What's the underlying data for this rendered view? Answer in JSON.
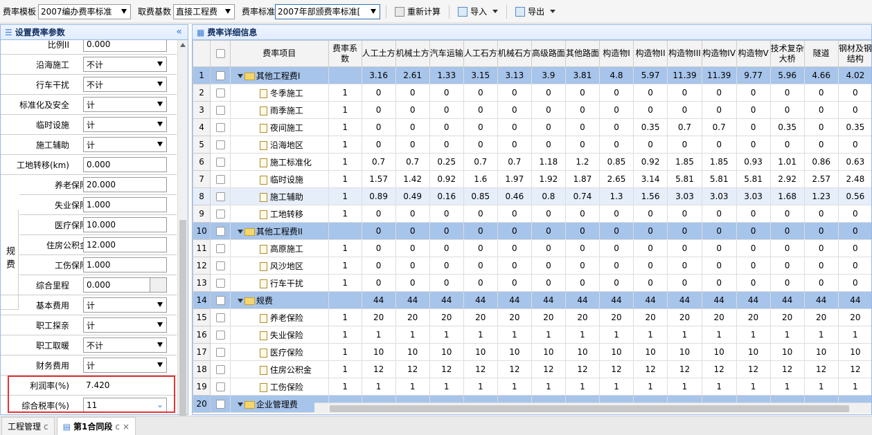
{
  "toolbar": {
    "template_label": "费率模板",
    "template_value": "2007编办费率标准",
    "base_label": "取费基数",
    "base_value": "直接工程费",
    "standard_label": "费率标准",
    "standard_value": "2007年部颁费率标准[",
    "recalc_label": "重新计算",
    "import_label": "导入",
    "export_label": "导出"
  },
  "left_panel": {
    "title": "设置费率参数",
    "collapse_icon": "double-chevron-left",
    "group_label": "规费",
    "rows": [
      {
        "label": "比例II",
        "value": "0.000",
        "type": "text"
      },
      {
        "label": "沿海施工",
        "value": "不计",
        "type": "select"
      },
      {
        "label": "行车干扰",
        "value": "不计",
        "type": "select"
      },
      {
        "label": "标准化及安全",
        "value": "计",
        "type": "select"
      },
      {
        "label": "临时设施",
        "value": "计",
        "type": "select"
      },
      {
        "label": "施工辅助",
        "value": "计",
        "type": "select"
      },
      {
        "label": "工地转移(km)",
        "value": "0.000",
        "type": "text"
      },
      {
        "label": "养老保险",
        "value": "20.000",
        "type": "text"
      },
      {
        "label": "失业保险",
        "value": "1.000",
        "type": "text"
      },
      {
        "label": "医疗保险",
        "value": "10.000",
        "type": "text"
      },
      {
        "label": "住房公积金",
        "value": "12.000",
        "type": "text"
      },
      {
        "label": "工伤保险",
        "value": "1.000",
        "type": "text"
      },
      {
        "label": "综合里程",
        "value": "0.000",
        "type": "date"
      },
      {
        "label": "基本费用",
        "value": "计",
        "type": "select"
      },
      {
        "label": "职工探亲",
        "value": "计",
        "type": "select"
      },
      {
        "label": "职工取暖",
        "value": "不计",
        "type": "select"
      },
      {
        "label": "财务费用",
        "value": "计",
        "type": "select"
      },
      {
        "label": "利润率(%)",
        "value": "7.420",
        "type": "plain"
      },
      {
        "label": "综合税率(%)",
        "value": "11",
        "type": "combo"
      }
    ]
  },
  "right_panel": {
    "title": "费率详细信息",
    "columns": [
      "费率项目",
      "费率系数",
      "人工土方",
      "机械土方",
      "汽车运输",
      "人工石方",
      "机械石方",
      "高级路面",
      "其他路面",
      "构造物I",
      "构造物II",
      "构造物III",
      "构造物IV",
      "构造物V",
      "技术复杂大桥",
      "隧道",
      "钢材及钢结构"
    ],
    "rows": [
      {
        "n": "1",
        "name": "其他工程费I",
        "group": true,
        "vals": [
          "",
          "3.16",
          "2.61",
          "1.33",
          "3.15",
          "3.13",
          "3.9",
          "3.81",
          "4.8",
          "5.97",
          "11.39",
          "11.39",
          "9.77",
          "5.96",
          "4.66",
          "4.02"
        ]
      },
      {
        "n": "2",
        "name": "冬季施工",
        "vals": [
          "1",
          "0",
          "0",
          "0",
          "0",
          "0",
          "0",
          "0",
          "0",
          "0",
          "0",
          "0",
          "0",
          "0",
          "0",
          "0"
        ]
      },
      {
        "n": "3",
        "name": "雨季施工",
        "vals": [
          "1",
          "0",
          "0",
          "0",
          "0",
          "0",
          "0",
          "0",
          "0",
          "0",
          "0",
          "0",
          "0",
          "0",
          "0",
          "0"
        ]
      },
      {
        "n": "4",
        "name": "夜间施工",
        "vals": [
          "1",
          "0",
          "0",
          "0",
          "0",
          "0",
          "0",
          "0",
          "0",
          "0.35",
          "0.7",
          "0.7",
          "0",
          "0.35",
          "0",
          "0.35"
        ]
      },
      {
        "n": "5",
        "name": "沿海地区",
        "vals": [
          "1",
          "0",
          "0",
          "0",
          "0",
          "0",
          "0",
          "0",
          "0",
          "0",
          "0",
          "0",
          "0",
          "0",
          "0",
          "0"
        ]
      },
      {
        "n": "6",
        "name": "施工标准化",
        "vals": [
          "1",
          "0.7",
          "0.7",
          "0.25",
          "0.7",
          "0.7",
          "1.18",
          "1.2",
          "0.85",
          "0.92",
          "1.85",
          "1.85",
          "0.93",
          "1.01",
          "0.86",
          "0.63"
        ]
      },
      {
        "n": "7",
        "name": "临时设施",
        "vals": [
          "1",
          "1.57",
          "1.42",
          "0.92",
          "1.6",
          "1.97",
          "1.92",
          "1.87",
          "2.65",
          "3.14",
          "5.81",
          "5.81",
          "5.81",
          "2.92",
          "2.57",
          "2.48"
        ]
      },
      {
        "n": "8",
        "name": "施工辅助",
        "hl": true,
        "vals": [
          "1",
          "0.89",
          "0.49",
          "0.16",
          "0.85",
          "0.46",
          "0.8",
          "0.74",
          "1.3",
          "1.56",
          "3.03",
          "3.03",
          "3.03",
          "1.68",
          "1.23",
          "0.56"
        ]
      },
      {
        "n": "9",
        "name": "工地转移",
        "vals": [
          "1",
          "0",
          "0",
          "0",
          "0",
          "0",
          "0",
          "0",
          "0",
          "0",
          "0",
          "0",
          "0",
          "0",
          "0",
          "0"
        ]
      },
      {
        "n": "10",
        "name": "其他工程费II",
        "group": true,
        "vals": [
          "",
          "0",
          "0",
          "0",
          "0",
          "0",
          "0",
          "0",
          "0",
          "0",
          "0",
          "0",
          "0",
          "0",
          "0",
          "0"
        ]
      },
      {
        "n": "11",
        "name": "高原施工",
        "vals": [
          "1",
          "0",
          "0",
          "0",
          "0",
          "0",
          "0",
          "0",
          "0",
          "0",
          "0",
          "0",
          "0",
          "0",
          "0",
          "0"
        ]
      },
      {
        "n": "12",
        "name": "风沙地区",
        "vals": [
          "1",
          "0",
          "0",
          "0",
          "0",
          "0",
          "0",
          "0",
          "0",
          "0",
          "0",
          "0",
          "0",
          "0",
          "0",
          "0"
        ]
      },
      {
        "n": "13",
        "name": "行车干扰",
        "vals": [
          "1",
          "0",
          "0",
          "0",
          "0",
          "0",
          "0",
          "0",
          "0",
          "0",
          "0",
          "0",
          "0",
          "0",
          "0",
          "0"
        ]
      },
      {
        "n": "14",
        "name": "规费",
        "group": true,
        "vals": [
          "",
          "44",
          "44",
          "44",
          "44",
          "44",
          "44",
          "44",
          "44",
          "44",
          "44",
          "44",
          "44",
          "44",
          "44",
          "44"
        ]
      },
      {
        "n": "15",
        "name": "养老保险",
        "vals": [
          "1",
          "20",
          "20",
          "20",
          "20",
          "20",
          "20",
          "20",
          "20",
          "20",
          "20",
          "20",
          "20",
          "20",
          "20",
          "20"
        ]
      },
      {
        "n": "16",
        "name": "失业保险",
        "vals": [
          "1",
          "1",
          "1",
          "1",
          "1",
          "1",
          "1",
          "1",
          "1",
          "1",
          "1",
          "1",
          "1",
          "1",
          "1",
          "1"
        ]
      },
      {
        "n": "17",
        "name": "医疗保险",
        "vals": [
          "1",
          "10",
          "10",
          "10",
          "10",
          "10",
          "10",
          "10",
          "10",
          "10",
          "10",
          "10",
          "10",
          "10",
          "10",
          "10"
        ]
      },
      {
        "n": "18",
        "name": "住房公积金",
        "vals": [
          "1",
          "12",
          "12",
          "12",
          "12",
          "12",
          "12",
          "12",
          "12",
          "12",
          "12",
          "12",
          "12",
          "12",
          "12",
          "12"
        ]
      },
      {
        "n": "19",
        "name": "工伤保险",
        "vals": [
          "1",
          "1",
          "1",
          "1",
          "1",
          "1",
          "1",
          "1",
          "1",
          "1",
          "1",
          "1",
          "1",
          "1",
          "1",
          "1"
        ]
      },
      {
        "n": "20",
        "name": "企业管理费",
        "group": true,
        "vals": [
          "",
          "",
          "",
          "",
          "",
          "",
          "",
          "",
          "",
          "",
          "",
          "",
          "",
          "",
          "",
          ""
        ]
      }
    ]
  },
  "tabs": [
    {
      "label": "工程管理",
      "refresh": "c"
    },
    {
      "label": "第1合同段",
      "refresh": "c",
      "close": "×"
    }
  ],
  "colors": {
    "header_bg": "#e0ecff",
    "group_row": "#a7c4ea",
    "highlight_border": "#e53333"
  }
}
